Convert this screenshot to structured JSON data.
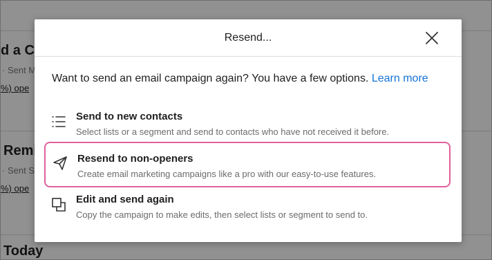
{
  "background": {
    "cards": [
      {
        "title": "d a C",
        "meta": "· Sent M",
        "link": "%) ope"
      },
      {
        "title": "Remi",
        "meta": "· Sent S",
        "link": "%) ope"
      },
      {
        "title": "Today"
      }
    ]
  },
  "modal": {
    "title": "Resend...",
    "close_icon": "close-icon",
    "intro": "Want to send an email campaign again? You have a few options.",
    "learn_more": "Learn more",
    "options": [
      {
        "icon": "list-icon",
        "title": "Send to new contacts",
        "description": "Select lists or a segment and send to contacts who have not received it before.",
        "selected": false
      },
      {
        "icon": "paper-plane-icon",
        "title": "Resend to non-openers",
        "description": "Create email marketing campaigns like a pro with our easy-to-use features.",
        "selected": true
      },
      {
        "icon": "copy-icon",
        "title": "Edit and send again",
        "description": "Copy the campaign to make edits, then select lists or segment to send to.",
        "selected": false
      }
    ]
  },
  "colors": {
    "selected_border": "#e0609a",
    "link": "#1673d9",
    "overlay": "rgba(0,0,0,0.42)"
  }
}
